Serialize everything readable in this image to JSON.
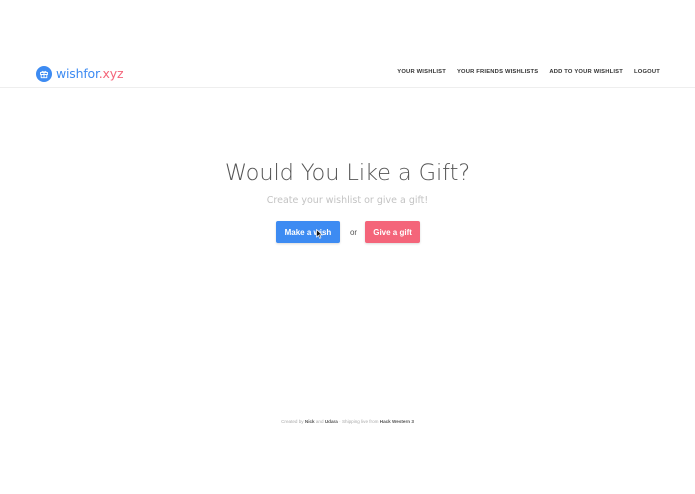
{
  "brand": {
    "name": "wishfor",
    "domain": ".xyz",
    "icon": "gift-icon",
    "icon_color": "#3d8bf2",
    "domain_color": "#f4657a"
  },
  "nav": {
    "items": [
      {
        "label": "YOUR WISHLIST"
      },
      {
        "label": "YOUR FRIENDS WISHLISTS"
      },
      {
        "label": "ADD TO YOUR WISHLIST"
      },
      {
        "label": "LOGOUT"
      }
    ]
  },
  "hero": {
    "title": "Would You Like a Gift?",
    "subtitle": "Create your wishlist or give a gift!"
  },
  "actions": {
    "make_wish_label": "Make a wish",
    "or_label": "or",
    "give_gift_label": "Give a gift",
    "wish_color": "#3d8bf2",
    "gift_color": "#f4657a"
  },
  "footer": {
    "created_by": "Created by",
    "author1": "Nick",
    "and": "and",
    "author2": "Udara",
    "sep": "·",
    "shipping": "Shipping live from",
    "event": "Hack Western 3"
  }
}
